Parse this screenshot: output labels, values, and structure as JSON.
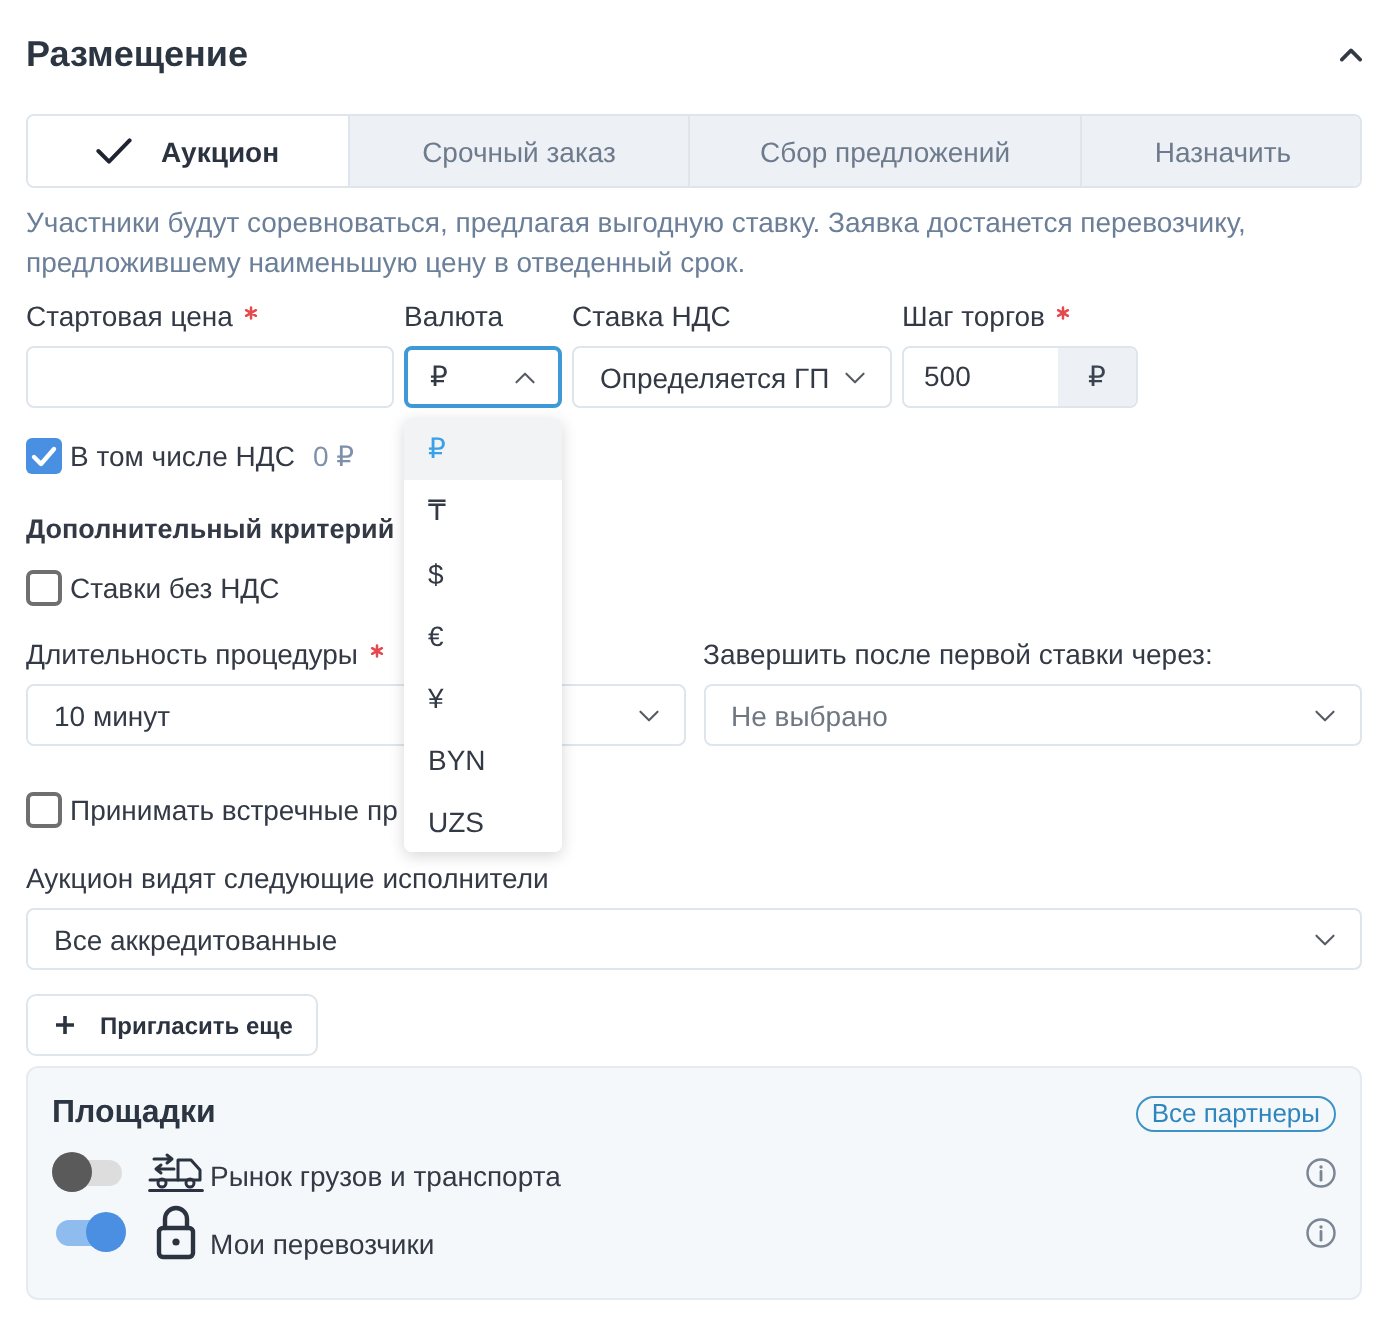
{
  "section": {
    "title": "Размещение",
    "expanded": true
  },
  "tabs": [
    {
      "label": "Аукцион",
      "selected": true
    },
    {
      "label": "Срочный заказ",
      "selected": false
    },
    {
      "label": "Сбор предложений",
      "selected": false
    },
    {
      "label": "Назначить",
      "selected": false
    }
  ],
  "description": "Участники будут соревноваться, предлагая выгодную ставку. Заявка достанется перевозчику, предложившему наименьшую цену в отведенный срок.",
  "price_fields": [
    {
      "kind": "input",
      "label": "Стартовая цена",
      "required": true
    },
    {
      "kind": "dropdown",
      "label": "Валюта",
      "required": false,
      "value": "₽",
      "expanded": true,
      "options": [
        {
          "label": "₽",
          "selected": true
        },
        {
          "label": "₸",
          "selected": false
        },
        {
          "label": "$",
          "selected": false
        },
        {
          "label": "€",
          "selected": false
        },
        {
          "label": "¥",
          "selected": false
        },
        {
          "label": "BYN",
          "selected": false
        },
        {
          "label": "UZS",
          "selected": false
        }
      ]
    },
    {
      "kind": "select",
      "label": "Ставка НДС",
      "required": false,
      "value": "Определяется ГП",
      "expanded": false
    },
    {
      "kind": "suffix_input",
      "label": "Шаг торгов",
      "required": true,
      "value": "500",
      "suffix": "₽"
    }
  ],
  "vat_included": {
    "label": "В том числе НДС",
    "checked": true,
    "amount": "0 ₽"
  },
  "extra_criterion": {
    "title": "Дополнительный критерий",
    "option": {
      "label": "Ставки без НДС",
      "checked": false
    }
  },
  "timing": [
    {
      "label": "Длительность процедуры",
      "required": true,
      "value": "10 минут",
      "expanded": false
    },
    {
      "label": "Завершить после первой ставки через:",
      "required": false,
      "placeholder": "Не выбрано",
      "expanded": false
    }
  ],
  "counter_offers": {
    "label": "Принимать встречные пр",
    "checked": false
  },
  "visibility": {
    "label": "Аукцион видят следующие исполнители",
    "value": "Все аккредитованные",
    "expanded": false
  },
  "invite_button": {
    "label": "Пригласить еще"
  },
  "platforms": {
    "title": "Площадки",
    "badge": "Все партнеры",
    "items": [
      {
        "kind": "truck",
        "label": "Рынок грузов и транспорта",
        "on": false
      },
      {
        "kind": "lock",
        "label": "Мои перевозчики",
        "on": true
      }
    ]
  }
}
